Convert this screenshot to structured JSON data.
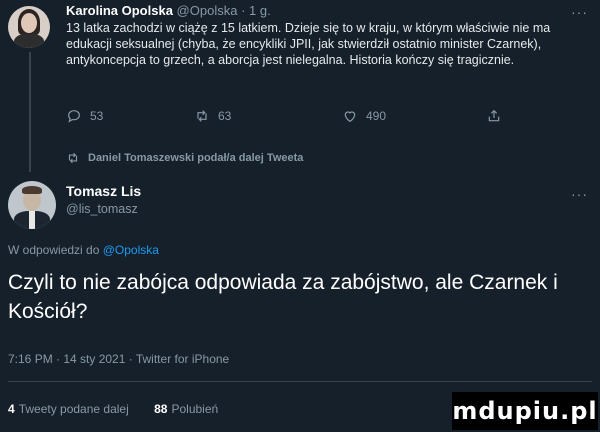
{
  "tweet1": {
    "author_name": "Karolina Opolska",
    "author_handle": "@Opolska",
    "separator": "·",
    "time_ago": "1 g.",
    "text": "13 latka zachodzi w ciążę z 15 latkiem. Dzieje się to w kraju, w którym właściwie nie ma edukacji seksualnej (chyba, że encykliki JPII, jak stwierdził ostatnio minister Czarnek), antykoncepcja to grzech, a aborcja jest nielegalna. Historia kończy się tragicznie.",
    "replies": "53",
    "retweets": "63",
    "likes": "490"
  },
  "retweet_notice": "Daniel Tomaszewski podał/a dalej Tweeta",
  "tweet2": {
    "author_name": "Tomasz Lis",
    "author_handle": "@lis_tomasz",
    "reply_prefix": "W odpowiedzi do",
    "reply_target": "@Opolska",
    "text": "Czyli to nie zabójca odpowiada za zabójstwo, ale Czarnek i Kościół?",
    "meta": "7:16 PM · 14 sty 2021 · Twitter for iPhone",
    "retweets_count": "4",
    "retweets_label": "Tweety podane dalej",
    "likes_count": "88",
    "likes_label": "Polubień"
  },
  "icons": {
    "reply": "reply-icon",
    "retweet": "retweet-icon",
    "like": "heart-icon",
    "share": "share-icon",
    "more": "more-icon"
  },
  "more_glyph": "···",
  "watermark": "mdupiu.pl",
  "colors": {
    "background": "#15202b",
    "link": "#1d9bf0",
    "muted": "#8899a6"
  }
}
